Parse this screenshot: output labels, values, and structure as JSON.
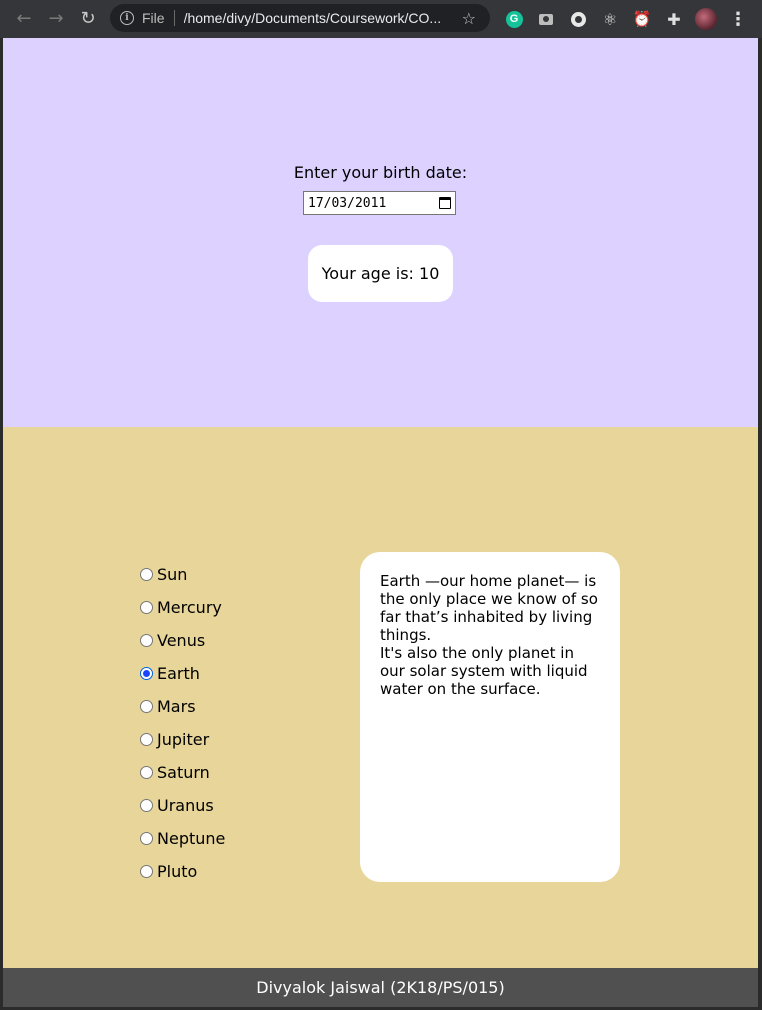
{
  "browser": {
    "back_icon": "←",
    "forward_icon": "→",
    "reload_icon": "↻",
    "scheme": "File",
    "url": "/home/divy/Documents/Coursework/CO...",
    "star_icon": "☆",
    "react_icon": "⚛",
    "alarm_icon": "⏰",
    "puzzle_icon": "✚",
    "menu_icon": "⋮",
    "grammarly_letter": "G"
  },
  "age": {
    "label": "Enter your birth date:",
    "date_value": "17/03/2011",
    "result_label": "Your age is: ",
    "result_value": "10"
  },
  "planets": {
    "items": [
      {
        "label": "Sun",
        "checked": false
      },
      {
        "label": "Mercury",
        "checked": false
      },
      {
        "label": "Venus",
        "checked": false
      },
      {
        "label": "Earth",
        "checked": true
      },
      {
        "label": "Mars",
        "checked": false
      },
      {
        "label": "Jupiter",
        "checked": false
      },
      {
        "label": "Saturn",
        "checked": false
      },
      {
        "label": "Uranus",
        "checked": false
      },
      {
        "label": "Neptune",
        "checked": false
      },
      {
        "label": "Pluto",
        "checked": false
      }
    ],
    "info_line1": "Earth —our home planet— is the only place we know of so far that’s inhabited by living things.",
    "info_line2": "It's also the only planet in our solar system with liquid water on the surface."
  },
  "footer": {
    "text": "Divyalok Jaiswal (2K18/PS/015)"
  },
  "colors": {
    "age_bg": "#ddd2ff",
    "planet_bg": "#e7d59a",
    "footer_bg": "#505050"
  }
}
